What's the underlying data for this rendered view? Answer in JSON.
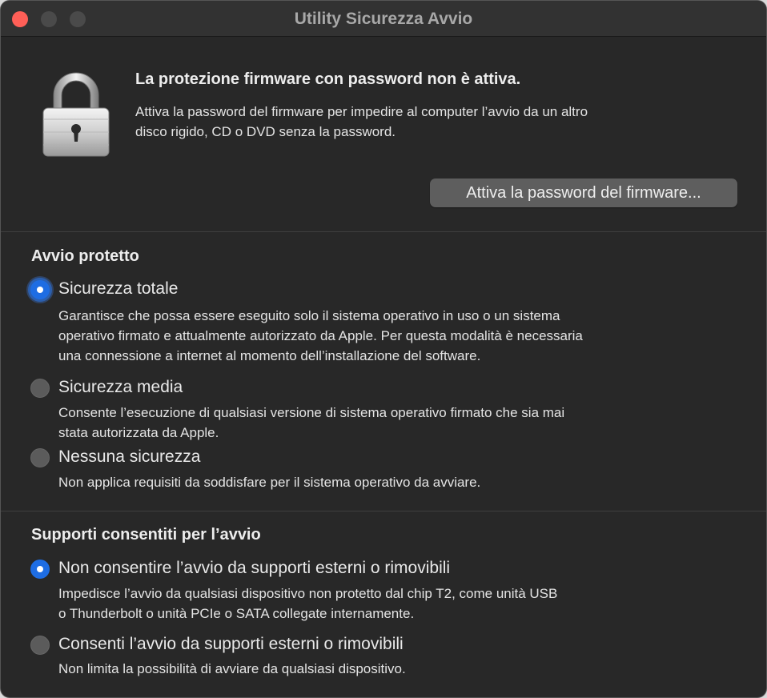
{
  "window": {
    "title": "Utility Sicurezza Avvio"
  },
  "firmware": {
    "icon": "padlock-icon",
    "headline": "La protezione firmware con password non è attiva.",
    "description_line1": "Attiva la password del firmware per impedire al computer l’avvio da un altro",
    "description_line2": "disco rigido, CD o DVD senza la password.",
    "button_label": "Attiva la password del firmware..."
  },
  "secure_boot": {
    "title": "Avvio protetto",
    "options": [
      {
        "label": "Sicurezza totale",
        "selected": true,
        "desc_lines": [
          "Garantisce che possa essere eseguito solo il sistema operativo in uso o un sistema",
          "operativo firmato e attualmente autorizzato da Apple. Per questa modalità è necessaria",
          "una connessione a internet al momento dell’installazione del software."
        ]
      },
      {
        "label": "Sicurezza media",
        "selected": false,
        "desc_lines": [
          "Consente l’esecuzione di qualsiasi versione di sistema operativo firmato che sia mai",
          "stata autorizzata da Apple."
        ]
      },
      {
        "label": "Nessuna sicurezza",
        "selected": false,
        "desc_lines": [
          "Non applica requisiti da soddisfare per il sistema operativo da avviare."
        ]
      }
    ]
  },
  "boot_media": {
    "title": "Supporti consentiti per l’avvio",
    "options": [
      {
        "label": "Non consentire l’avvio da supporti esterni o rimovibili",
        "selected": true,
        "desc_lines": [
          "Impedisce l’avvio da qualsiasi dispositivo non protetto dal chip T2, come unità USB",
          "o Thunderbolt o unità PCIe o SATA collegate internamente."
        ]
      },
      {
        "label": "Consenti l’avvio da supporti esterni o rimovibili",
        "selected": false,
        "desc_lines": [
          "Non limita la possibilità di avviare da qualsiasi dispositivo."
        ]
      }
    ]
  },
  "colors": {
    "accent": "#1e6de3",
    "window_bg": "#282828",
    "close": "#ff5f57"
  }
}
